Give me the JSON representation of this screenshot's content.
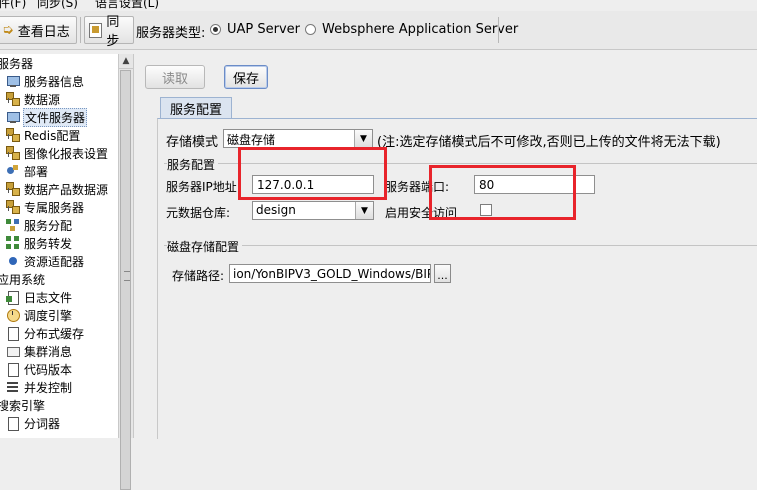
{
  "menubar": {
    "items": [
      "件(F)",
      "同步(S)",
      "语言设置(L)"
    ]
  },
  "toolbar": {
    "log_button": "查看日志",
    "sync_button": "同步",
    "server_type_label": "服务器类型:",
    "server_options": [
      "UAP Server",
      "Websphere Application Server"
    ],
    "selected_server": "UAP Server"
  },
  "tree": {
    "items": [
      {
        "label": "服务器",
        "level": 0,
        "icon": "folder-open-icon"
      },
      {
        "label": "服务器信息",
        "level": 1,
        "icon": "monitor-icon"
      },
      {
        "label": "数据源",
        "level": 1,
        "icon": "datasource-icon"
      },
      {
        "label": "文件服务器",
        "level": 1,
        "icon": "monitor-icon",
        "selected": true
      },
      {
        "label": "Redis配置",
        "level": 1,
        "icon": "datasource-icon"
      },
      {
        "label": "图像化报表设置",
        "level": 1,
        "icon": "datasource-icon"
      },
      {
        "label": "部署",
        "level": 1,
        "icon": "deploy-icon"
      },
      {
        "label": "数据产品数据源",
        "level": 1,
        "icon": "datasource-icon"
      },
      {
        "label": "专属服务器",
        "level": 1,
        "icon": "datasource-icon"
      },
      {
        "label": "服务分配",
        "level": 1,
        "icon": "distribute-icon"
      },
      {
        "label": "服务转发",
        "level": 1,
        "icon": "forward-icon"
      },
      {
        "label": "资源适配器",
        "level": 1,
        "icon": "adapter-icon"
      },
      {
        "label": "应用系统",
        "level": 0,
        "icon": "folder-open-icon"
      },
      {
        "label": "日志文件",
        "level": 1,
        "icon": "log-file-icon"
      },
      {
        "label": "调度引擎",
        "level": 1,
        "icon": "clock-icon"
      },
      {
        "label": "分布式缓存",
        "level": 1,
        "icon": "document-icon"
      },
      {
        "label": "集群消息",
        "level": 1,
        "icon": "mail-icon"
      },
      {
        "label": "代码版本",
        "level": 1,
        "icon": "document-icon"
      },
      {
        "label": "并发控制",
        "level": 1,
        "icon": "list-icon"
      },
      {
        "label": "搜索引擎",
        "level": 0,
        "icon": "folder-open-icon"
      },
      {
        "label": "分词器",
        "level": 1,
        "icon": "document-icon"
      }
    ]
  },
  "actions": {
    "read_button": "读取",
    "save_button": "保存"
  },
  "tab": {
    "label": "服务配置"
  },
  "form": {
    "storage_mode_label": "存储模式",
    "storage_mode_value": "磁盘存储",
    "storage_mode_note": "(注:选定存储模式后不可修改,否则已上传的文件将无法下载)",
    "service_group_title": "服务配置",
    "ip_label": "服务器IP地址:",
    "ip_value": "127.0.0.1",
    "port_label": "服务器端口:",
    "port_value": "80",
    "metadata_label": "元数据仓库:",
    "metadata_value": "design",
    "secure_label": "启用安全访问",
    "secure_checked": false,
    "disk_group_title": "磁盘存储配置",
    "path_label": "存储路径:",
    "path_value": "ion/YonBIPV3_GOLD_Windows/BIP",
    "browse_label": "..."
  },
  "colors": {
    "highlight_box": "#e8242b",
    "tab_bg": "#dbe4f0",
    "selection_bg": "#dfe9f6"
  }
}
